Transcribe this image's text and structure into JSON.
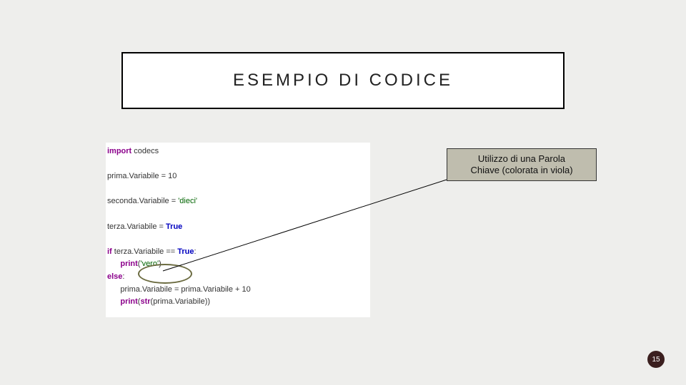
{
  "title": "ESEMPIO DI CODICE",
  "callout": {
    "line1": "Utilizzo di una Parola",
    "line2": "Chiave (colorata in viola)"
  },
  "code": {
    "kw_import": "import",
    "mod_codecs": "codecs",
    "v1_name": "prima.Variabile",
    "eq": " = ",
    "v1_val": "10",
    "v2_name": "seconda.Variabile",
    "v2_val": "'dieci'",
    "v3_name": "terza.Variabile",
    "lit_true": "True",
    "kw_if": "if",
    "cond_var": "terza.Variabile",
    "op_eq": " == ",
    "colon": ":",
    "kw_print": "print",
    "arg_vero": "'vero'",
    "kw_else": "else",
    "assign_line": "prima.Variabile = prima.Variabile + 10",
    "kw_str": "str",
    "str_arg": "(prima.Variabile))",
    "lparen": "(",
    "rparen": ")"
  },
  "page_number": "15"
}
